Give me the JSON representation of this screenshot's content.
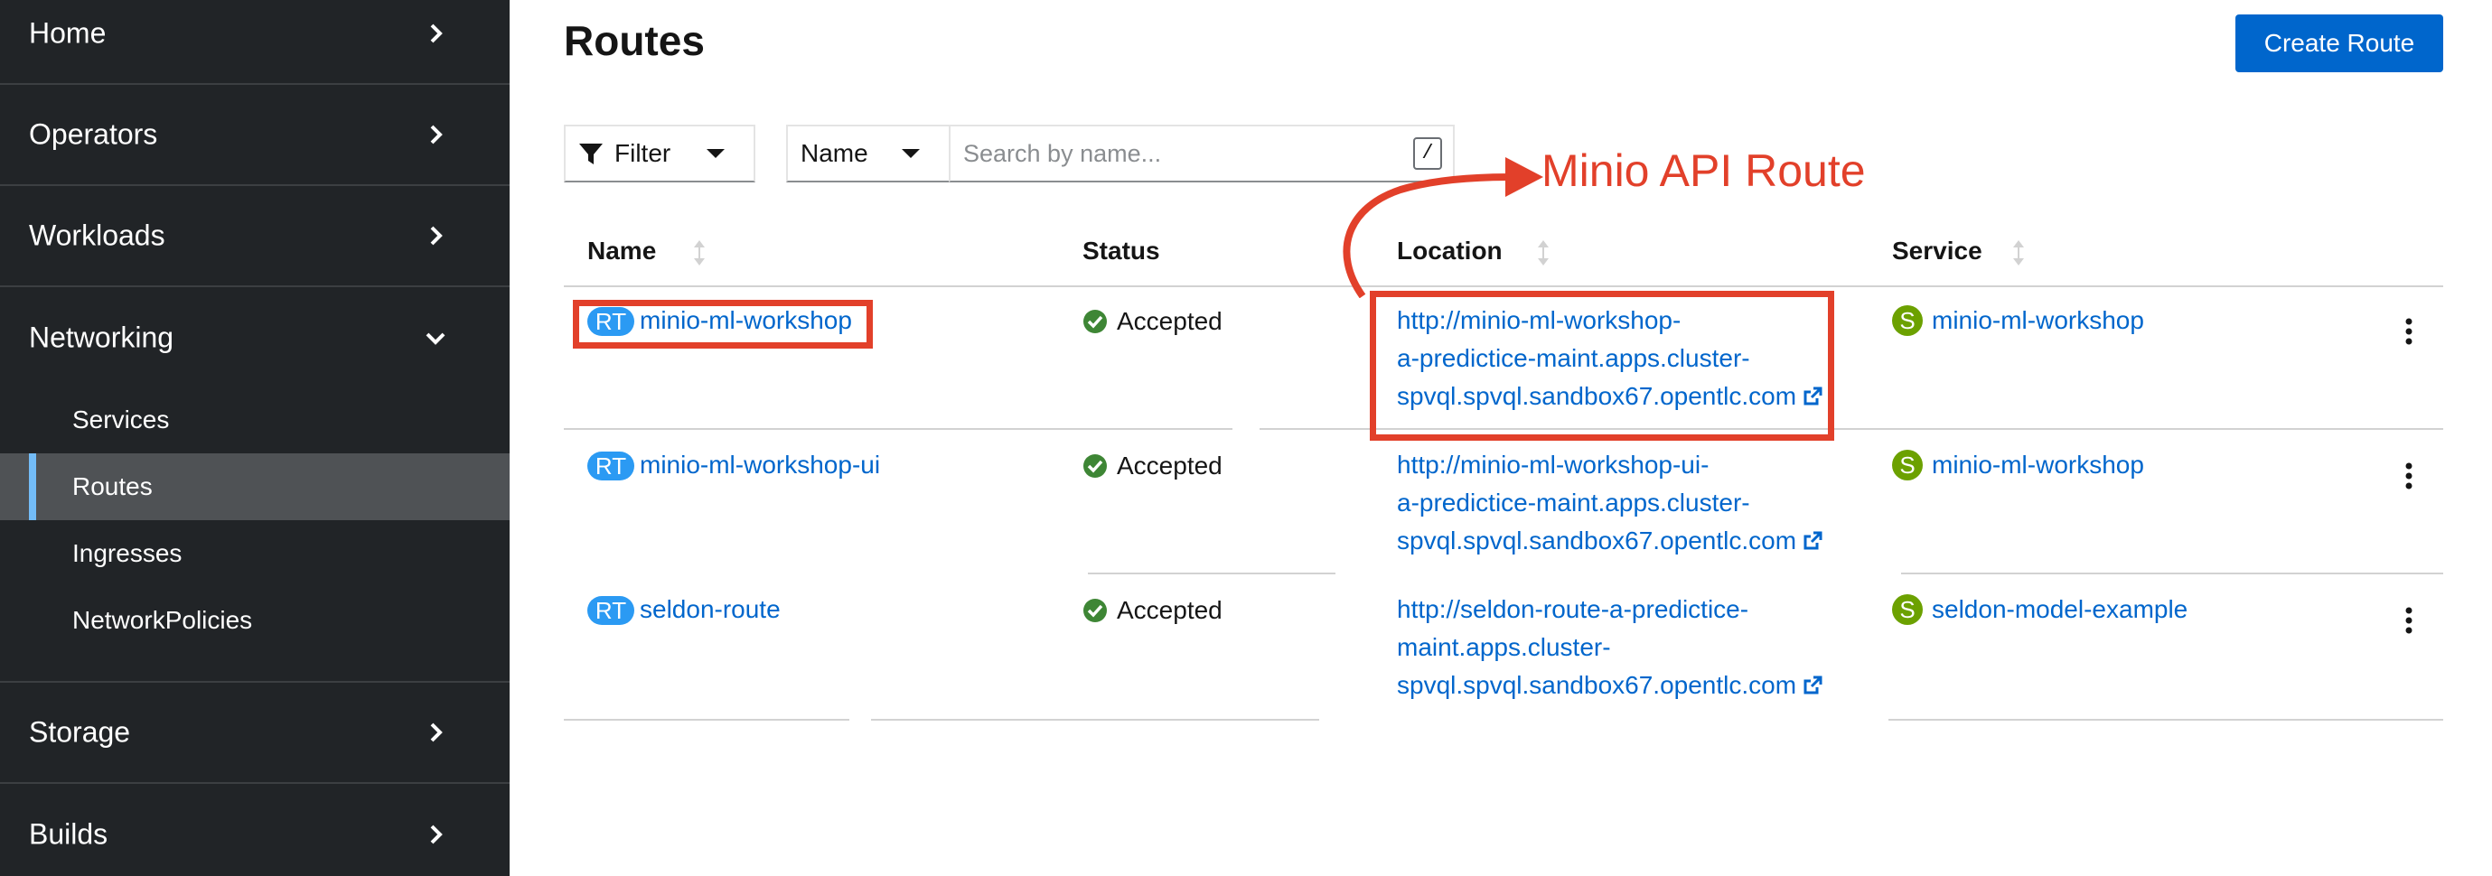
{
  "sidebar": {
    "groups": [
      {
        "label": "Home"
      },
      {
        "label": "Operators"
      },
      {
        "label": "Workloads"
      },
      {
        "label": "Networking"
      },
      {
        "label": "Storage"
      },
      {
        "label": "Builds"
      }
    ],
    "networking_items": [
      {
        "label": "Services"
      },
      {
        "label": "Routes"
      },
      {
        "label": "Ingresses"
      },
      {
        "label": "NetworkPolicies"
      }
    ],
    "active_item": "Routes"
  },
  "page": {
    "title": "Routes",
    "create_button": "Create Route"
  },
  "toolbar": {
    "filter_label": "Filter",
    "attribute_select": "Name",
    "search_placeholder": "Search by name...",
    "search_value": "",
    "shortcut_key": "/"
  },
  "table": {
    "columns": [
      "Name",
      "Status",
      "Location",
      "Service"
    ],
    "rows": [
      {
        "badge": "RT",
        "name": "minio-ml-workshop",
        "status": "Accepted",
        "location_lines": [
          "http://minio-ml-workshop-",
          "a-predictice-maint.apps.cluster-",
          "spvql.spvql.sandbox67.opentlc.com"
        ],
        "service_badge": "S",
        "service": "minio-ml-workshop"
      },
      {
        "badge": "RT",
        "name": "minio-ml-workshop-ui",
        "status": "Accepted",
        "location_lines": [
          "http://minio-ml-workshop-ui-",
          "a-predictice-maint.apps.cluster-",
          "spvql.spvql.sandbox67.opentlc.com"
        ],
        "service_badge": "S",
        "service": "minio-ml-workshop"
      },
      {
        "badge": "RT",
        "name": "seldon-route",
        "status": "Accepted",
        "location_lines": [
          "http://seldon-route-a-predictice-",
          "maint.apps.cluster-",
          "spvql.spvql.sandbox67.opentlc.com"
        ],
        "service_badge": "S",
        "service": "seldon-model-example"
      }
    ]
  },
  "annotation": {
    "text": "Minio API Route",
    "color": "#e2402a"
  },
  "colors": {
    "sidebar_bg": "#212427",
    "active_bg": "#4f5255",
    "active_accent": "#73bcf7",
    "primary": "#0066cc",
    "route_badge": "#2b9af3",
    "service_badge": "#6ca100",
    "status_ok": "#3e8635"
  }
}
